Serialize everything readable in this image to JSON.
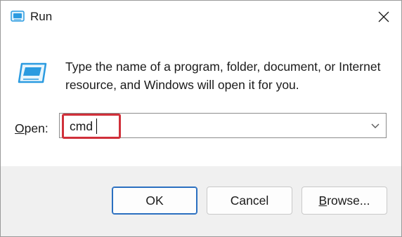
{
  "window": {
    "title": "Run",
    "close_icon": "close-icon"
  },
  "body": {
    "description": "Type the name of a program, folder, document, or Internet resource, and Windows will open it for you.",
    "open_label_underlined": "O",
    "open_label_rest": "pen:",
    "open_input_value": "cmd"
  },
  "buttons": {
    "ok_label": "OK",
    "cancel_label": "Cancel",
    "browse_underlined": "B",
    "browse_rest": "rowse..."
  },
  "colors": {
    "highlight": "#d0303a",
    "accent": "#2a6fc0",
    "icon_blue": "#2b9be0"
  }
}
